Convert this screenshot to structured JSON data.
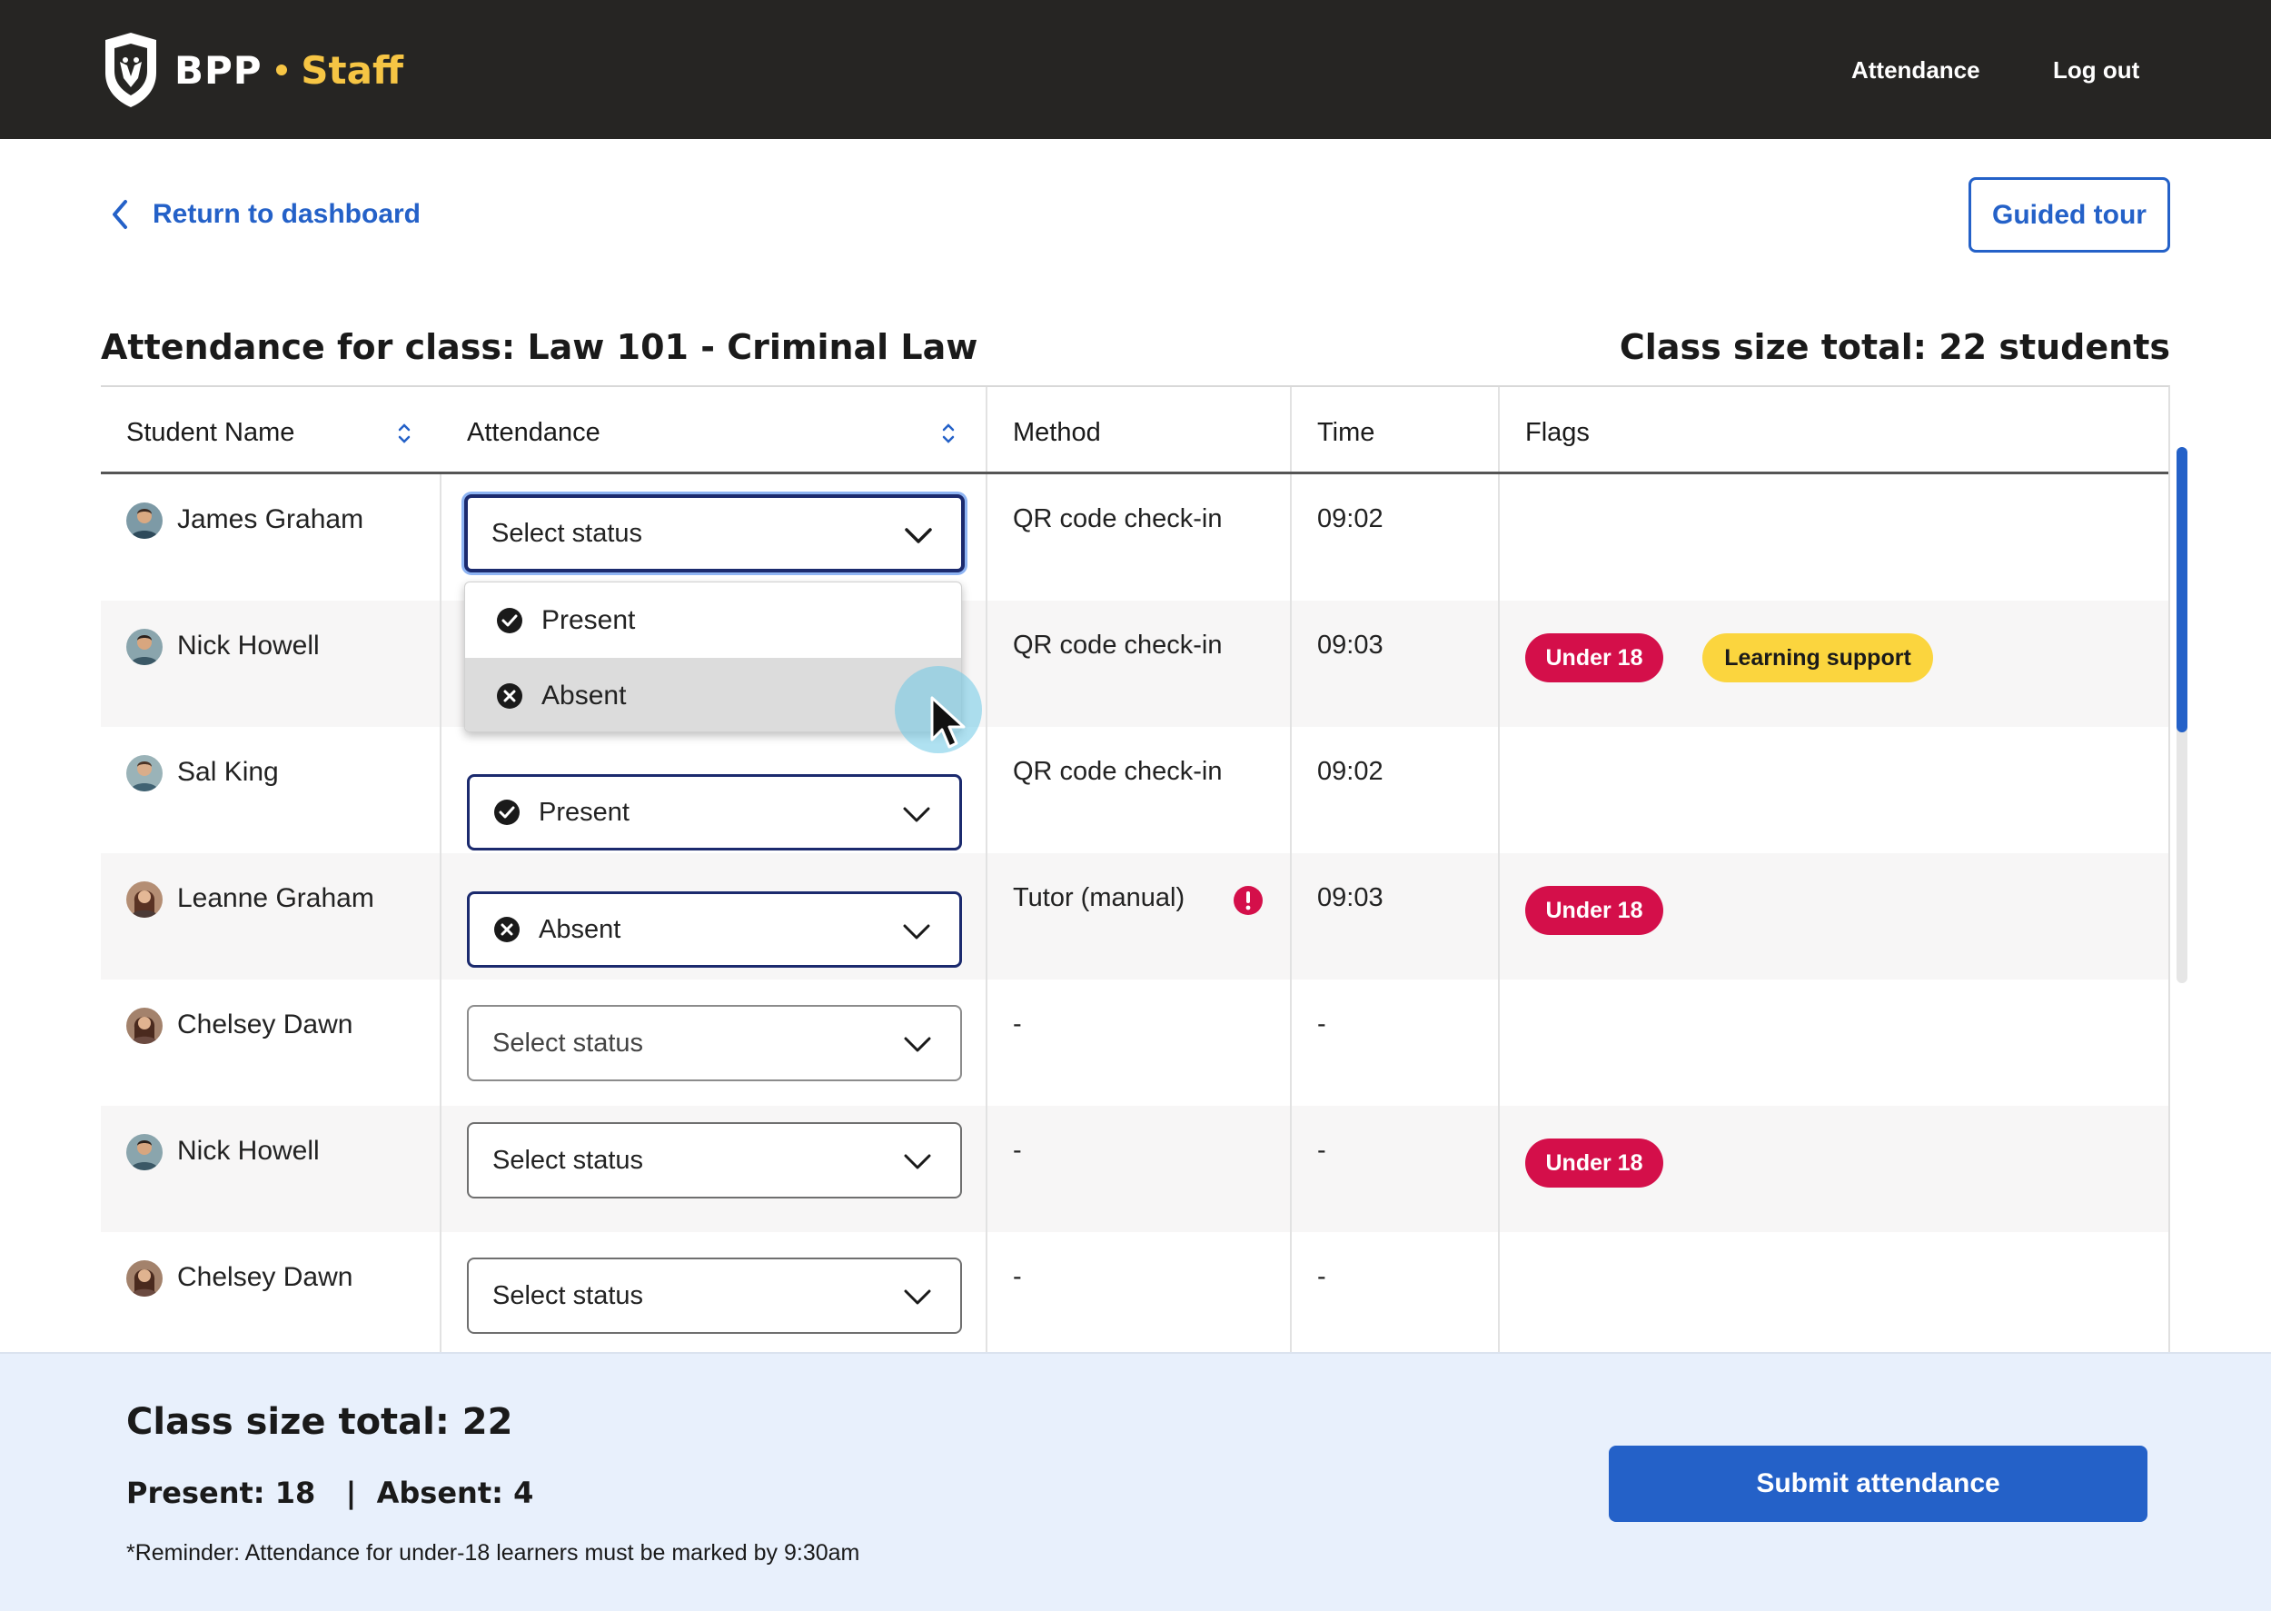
{
  "header": {
    "brand_name": "BPP",
    "brand_separator": "•",
    "brand_sub": "Staff",
    "nav": [
      {
        "label": "Attendance"
      },
      {
        "label": "Log out"
      }
    ]
  },
  "subheader": {
    "back_label": "Return to dashboard",
    "guided_tour_label": "Guided tour"
  },
  "class": {
    "title": "Attendance for class: Law 101 - Criminal Law",
    "size_label": "Class size total: 22 students"
  },
  "table": {
    "columns": [
      "Student Name",
      "Attendance",
      "Method",
      "Time",
      "Flags"
    ],
    "rows": [
      {
        "name": "James Graham",
        "status": "Select status",
        "method": "QR code check-in",
        "time": "09:02",
        "flags": []
      },
      {
        "name": "Nick Howell",
        "status": "",
        "method": "QR code check-in",
        "time": "09:03",
        "flags": [
          "Under 18",
          "Learning support"
        ]
      },
      {
        "name": "Sal King",
        "status": "Present",
        "method": "QR code check-in",
        "time": "09:02",
        "flags": []
      },
      {
        "name": "Leanne Graham",
        "status": "Absent",
        "method": "Tutor (manual)",
        "time": "09:03",
        "flags": [
          "Under 18"
        ]
      },
      {
        "name": "Chelsey Dawn",
        "status": "Select status",
        "method": "-",
        "time": "-",
        "flags": []
      },
      {
        "name": "Nick Howell",
        "status": "Select status",
        "method": "-",
        "time": "-",
        "flags": [
          "Under 18"
        ]
      },
      {
        "name": "Chelsey Dawn",
        "status": "Select status",
        "method": "-",
        "time": "-",
        "flags": []
      }
    ]
  },
  "dropdown": {
    "options": [
      "Present",
      "Absent"
    ],
    "hovered": "Absent"
  },
  "summary": {
    "total": "Class size total: 22",
    "counts": "Present: 18   |  Absent: 4",
    "reminder": "*Reminder: Attendance for under-18 learners must be marked by 9:30am",
    "submit_label": "Submit attendance"
  },
  "colors": {
    "header_bg": "#262523",
    "brand_accent": "#f6c544",
    "primary": "#2461c8",
    "select_border": "#1b2a6e",
    "badge_red": "#d40f4a",
    "badge_yellow": "#fbd53e",
    "summary_bg": "#e8f0fc"
  }
}
